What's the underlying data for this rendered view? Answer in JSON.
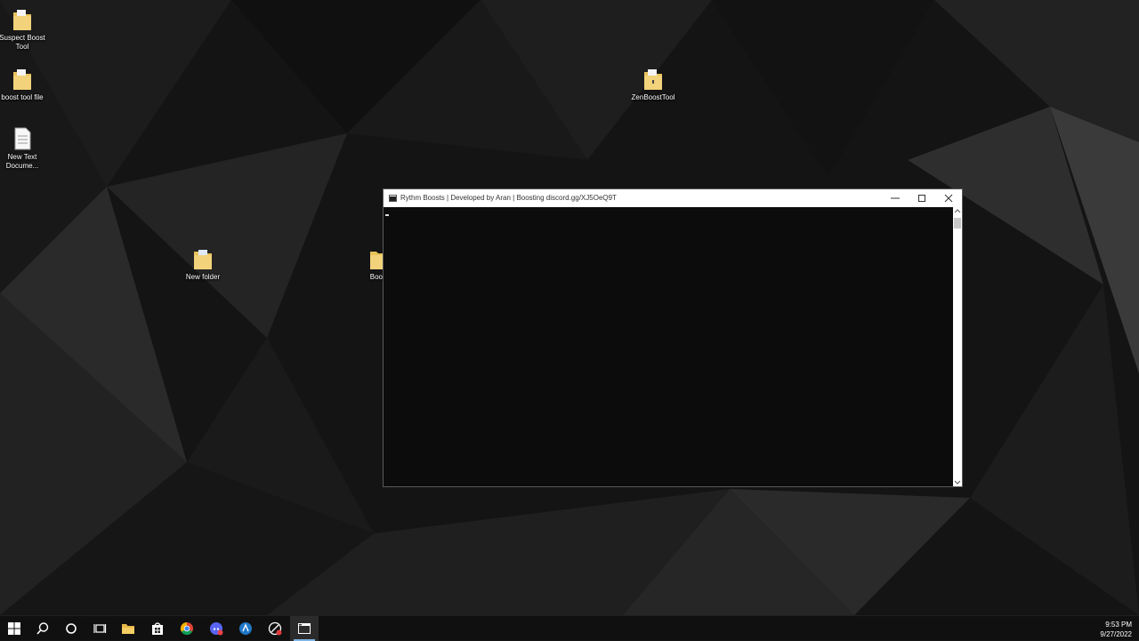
{
  "desktop": {
    "icons": [
      {
        "label": "Suspect Boost Tool"
      },
      {
        "label": "boost tool file"
      },
      {
        "label": "New Text Docume..."
      },
      {
        "label": "New folder"
      },
      {
        "label": "Boost"
      },
      {
        "label": "ZenBoostTool"
      }
    ]
  },
  "console_window": {
    "title": "Rythm Boosts | Developed by Aran | Boosting discord.gg/XJ5OeQ9T",
    "minimize_icon": "minimize-icon",
    "maximize_icon": "maximize-icon",
    "close_icon": "close-icon"
  },
  "taskbar": {
    "items": [
      {
        "icon": "windows-start-icon"
      },
      {
        "icon": "search-icon"
      },
      {
        "icon": "cortana-icon"
      },
      {
        "icon": "task-view-icon"
      },
      {
        "icon": "file-explorer-icon"
      },
      {
        "icon": "store-icon"
      },
      {
        "icon": "chrome-icon"
      },
      {
        "icon": "discord-icon"
      },
      {
        "icon": "app-icon"
      },
      {
        "icon": "app-icon"
      },
      {
        "icon": "console-icon"
      }
    ],
    "clock": {
      "time": "9:53 PM",
      "date": "9/27/2022"
    }
  },
  "colors": {
    "console_bg": "#0c0c0c",
    "titlebar_bg": "#ffffff",
    "taskbar_bg": "#101010",
    "active_indicator": "#7fb5e6"
  }
}
